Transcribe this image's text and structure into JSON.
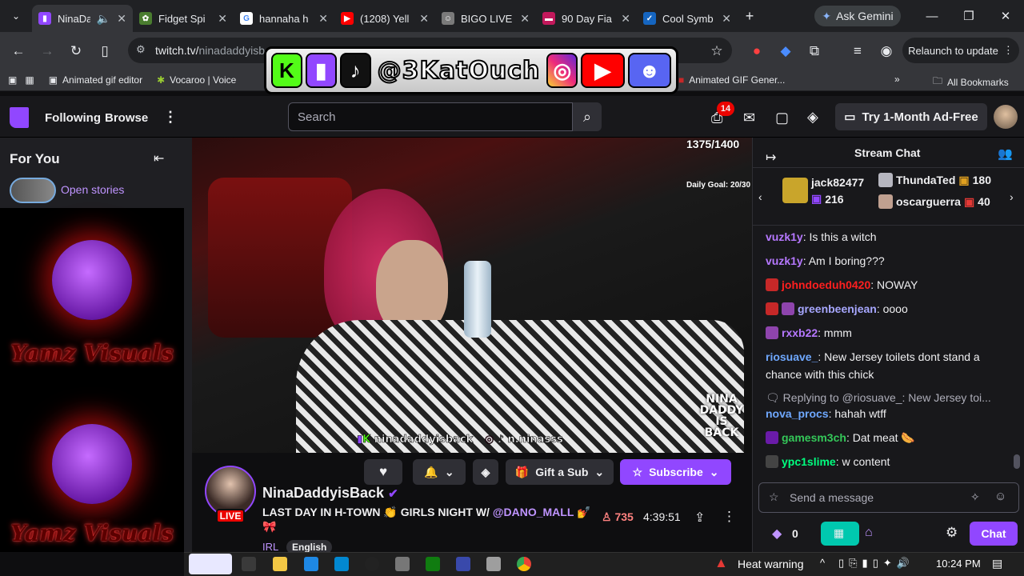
{
  "tabs": [
    {
      "title": "NinaDa",
      "favicon": "twitch-icon",
      "color": "#9147ff",
      "active": true
    },
    {
      "title": "Fidget Spi",
      "favicon": "fidget-icon",
      "color": "#4a7d2f"
    },
    {
      "title": "hannaha h",
      "favicon": "google-icon",
      "color": "#4285f4"
    },
    {
      "title": "(1208) Yell",
      "favicon": "youtube-icon",
      "color": "#ff0000"
    },
    {
      "title": "BIGO LIVE",
      "favicon": "bigo-icon",
      "color": "#7a7a7a"
    },
    {
      "title": "90 Day Fia",
      "favicon": "tlc-icon",
      "color": "#c2185b"
    },
    {
      "title": "Cool Symb",
      "favicon": "check-icon",
      "color": "#1565c0"
    }
  ],
  "gemini_label": "Ask Gemini",
  "address": {
    "host": "twitch.tv/",
    "path": "ninadaddyisb"
  },
  "relaunch_label": "Relaunch to update",
  "bookmarks": [
    {
      "label": "Animated gif editor",
      "icon": "gif-icon"
    },
    {
      "label": "Vocaroo | Voice",
      "icon": "vocaroo-icon"
    },
    {
      "label": "Animated GIF Gener...",
      "icon": "gif-generator-icon"
    }
  ],
  "all_bookmarks_label": "All Bookmarks",
  "overlay": {
    "handle": "@3KatOuch"
  },
  "nav": {
    "following": "Following",
    "browse": "Browse",
    "search_placeholder": "Search",
    "notif_count": "14",
    "adfree": "Try 1-Month Ad-Free"
  },
  "sidebar": {
    "for_you": "For You",
    "open_stories": "Open stories",
    "promo_text": "Yamz Visuals"
  },
  "video": {
    "goal_count": "1375/1400",
    "daily_goal": "Daily Goal: 20/30",
    "handle_text": "ninadaddyisback",
    "ig_text": "n.ninasss",
    "watermark": "NINA DADDY IS BACK"
  },
  "channel": {
    "name": "NinaDaddyisBack",
    "live": "LIVE",
    "title_prefix": "LAST DAY IN H-TOWN 👏 GIRLS NIGHT W/ ",
    "title_mention": "@DANO_MALL",
    "title_suffix": " 💅 🎀",
    "category": "IRL",
    "language": "English",
    "viewers": "735",
    "uptime": "4:39:51",
    "gift_label": "Gift a Sub",
    "subscribe_label": "Subscribe"
  },
  "chat": {
    "title": "Stream Chat",
    "gifters": [
      {
        "name": "jack82477",
        "count": "216"
      },
      {
        "name": "ThundaTed",
        "count": "180"
      },
      {
        "name": "oscarguerra",
        "count": "40"
      }
    ],
    "messages": [
      {
        "user": "vuzk1y",
        "color": "#b678ff",
        "text": ": Is this a witch"
      },
      {
        "user": "vuzk1y",
        "color": "#b678ff",
        "text": ": Am I boring???"
      },
      {
        "user": "johndoeduh0420",
        "color": "#ff1f1f",
        "text": ": NOWAY"
      },
      {
        "user": "greenbeenjean",
        "color": "#a7a7ff",
        "text": ": oooo"
      },
      {
        "user": "rxxb22",
        "color": "#b678ff",
        "text": ": mmm"
      },
      {
        "user": "riosuave_",
        "color": "#6fa8ff",
        "text": ": New Jersey toilets dont stand a chance with this chick"
      },
      {
        "user": "nova_procs",
        "color": "#6fa8ff",
        "text": ": hahah wtff"
      },
      {
        "user": "gamesm3ch",
        "color": "#34c759",
        "text": ": Dat meat 🌭"
      },
      {
        "user": "ypc1slime",
        "color": "#00ff7f",
        "text": ": w content"
      }
    ],
    "reply_text": "Replying to @riosuave_: New Jersey toi...",
    "send_placeholder": "Send a message",
    "points": "0",
    "chat_button": "Chat"
  },
  "taskbar": {
    "heat_warning": "Heat warning",
    "time": "10:24 PM"
  },
  "colors": {
    "twitch_purple": "#9147ff",
    "live_red": "#eb0400"
  }
}
